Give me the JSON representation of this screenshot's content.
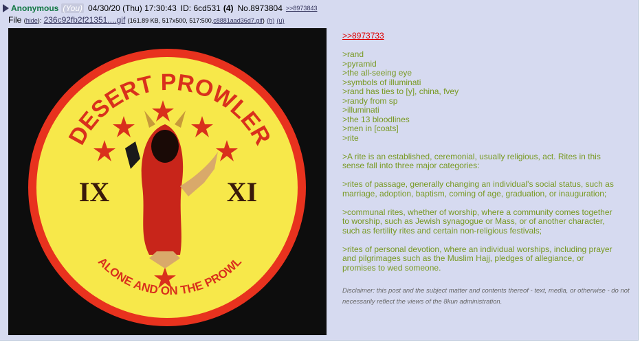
{
  "post": {
    "name": "Anonymous",
    "you_tag": "(You)",
    "datetime": "04/30/20 (Thu) 17:30:43",
    "id_label": "ID: 6cd531",
    "id_count": "(4)",
    "post_number": "No.8973804",
    "backlink": ">>8973843",
    "file": {
      "prefix": "File",
      "hide": "hide",
      "filename": "236c92fb2f21351....gif",
      "meta": "(161.89 KB, 517x500, 517:500,",
      "hash": "c8881aad36d7.gif",
      "meta_close": ")",
      "h_link": "(h)",
      "u_link": "(u)"
    },
    "image": {
      "patch_top_text": "DESERT PROWLER",
      "patch_left_numeral": "IX",
      "patch_right_numeral": "XI",
      "patch_bottom_text": "ALONE AND ON THE PROWL"
    },
    "body": {
      "quote_link": ">>8973733",
      "lines_block1": [
        ">rand",
        ">pyramid",
        ">the all-seeing eye",
        ">symbols of illuminati",
        ">rand has ties to [y], china, fvey",
        ">randy from sp",
        ">illuminati",
        ">the 13 bloodlines",
        ">men in [coats]",
        ">rite"
      ],
      "para1": ">A rite is an established, ceremonial, usually religious, act. Rites in this sense fall into three major categories:",
      "para2": ">rites of passage, generally changing an individual's social status, such as marriage, adoption, baptism, coming of age, graduation, or inauguration;",
      "para3": ">communal rites, whether of worship, where a community comes together to worship, such as Jewish synagogue or Mass, or of another character, such as fertility rites and certain non-religious festivals;",
      "para4": ">rites of personal devotion, where an individual worships, including prayer and pilgrimages such as the Muslim Hajj, pledges of allegiance, or promises to wed someone."
    },
    "disclaimer": "Disclaimer: this post and the subject matter and contents thereof - text, media, or otherwise - do not necessarily reflect the views of the 8kun administration."
  },
  "colors": {
    "post_bg": "#d6daf0",
    "name": "#117743",
    "greentext": "#789922",
    "quote_link": "#dd0000"
  }
}
